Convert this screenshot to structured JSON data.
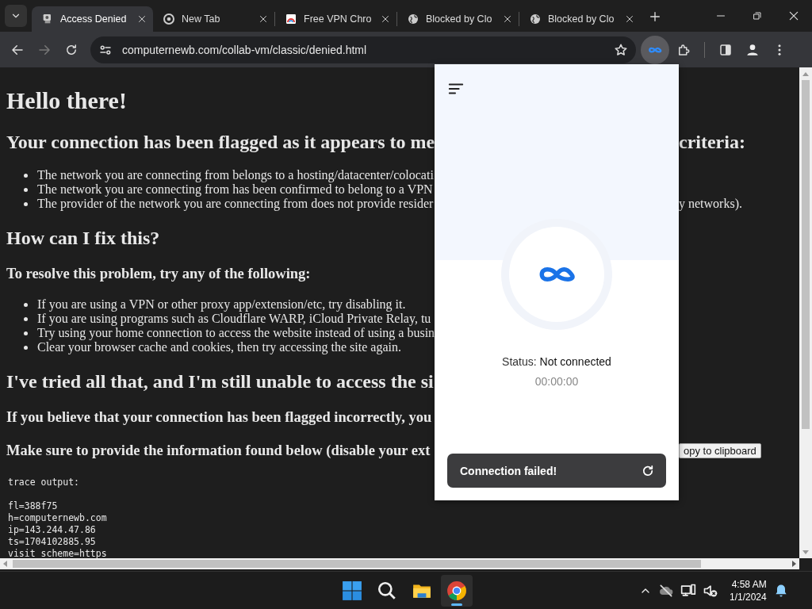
{
  "tabs": [
    {
      "title": "Access Denied",
      "kind": "page",
      "selected": true
    },
    {
      "title": "New Tab",
      "kind": "chrome",
      "selected": false
    },
    {
      "title": "Free VPN Chro",
      "kind": "vpn",
      "selected": false
    },
    {
      "title": "Blocked by Clo",
      "kind": "globe",
      "selected": false
    },
    {
      "title": "Blocked by Clo",
      "kind": "globe",
      "selected": false
    }
  ],
  "toolbar": {
    "url": "computernewb.com/collab-vm/classic/denied.html",
    "forward_disabled": true
  },
  "page": {
    "blocks": [
      {
        "kind": "h1",
        "text": "Hello there!"
      },
      {
        "kind": "h2",
        "text": "Your connection has been flagged as it appears to me",
        "right": "criteria:"
      },
      {
        "kind": "list",
        "items": [
          {
            "text": "The network you are connecting from belongs to a hosting/datacenter/colocati"
          },
          {
            "text": "The network you are connecting from has been confirmed to belong to a VPN"
          },
          {
            "text": "The provider of the network you are connecting from does not provide resider",
            "right": "y networks)."
          }
        ]
      },
      {
        "kind": "h2",
        "text": "How can I fix this?"
      },
      {
        "kind": "h3",
        "text": "To resolve this problem, try any of the following:"
      },
      {
        "kind": "list",
        "items": [
          {
            "text": "If you are using a VPN or other proxy app/extension/etc, try disabling it."
          },
          {
            "text": "If you are using programs such as Cloudflare WARP, iCloud Private Relay, tu"
          },
          {
            "text": "Try using your home connection to access the website instead of using a busin"
          },
          {
            "text": "Clear your browser cache and cookies, then try accessing the site again."
          }
        ]
      },
      {
        "kind": "h2",
        "text": "I've tried all that, and I'm still unable to access the si"
      },
      {
        "kind": "h3",
        "text": "If you believe that your connection has been flagged incorrectly, you"
      },
      {
        "kind": "h3",
        "text": "Make sure to provide the information found below (disable your ext",
        "button": "opy to clipboard"
      },
      {
        "kind": "pre",
        "title": "trace output:",
        "lines": [
          "fl=388f75",
          "h=computernewb.com",
          "ip=143.244.47.86",
          "ts=1704102885.95",
          "visit_scheme=https"
        ]
      }
    ]
  },
  "popup": {
    "status_label": "Status:",
    "status_value": "Not connected",
    "timer": "00:00:00",
    "toast": "Connection failed!"
  },
  "taskbar": {
    "apps": [
      {
        "kind": "start",
        "active": false
      },
      {
        "kind": "search",
        "active": false
      },
      {
        "kind": "explorer",
        "active": false
      },
      {
        "kind": "chrome",
        "active": true
      }
    ],
    "time": "4:58 AM",
    "date": "1/1/2024"
  }
}
